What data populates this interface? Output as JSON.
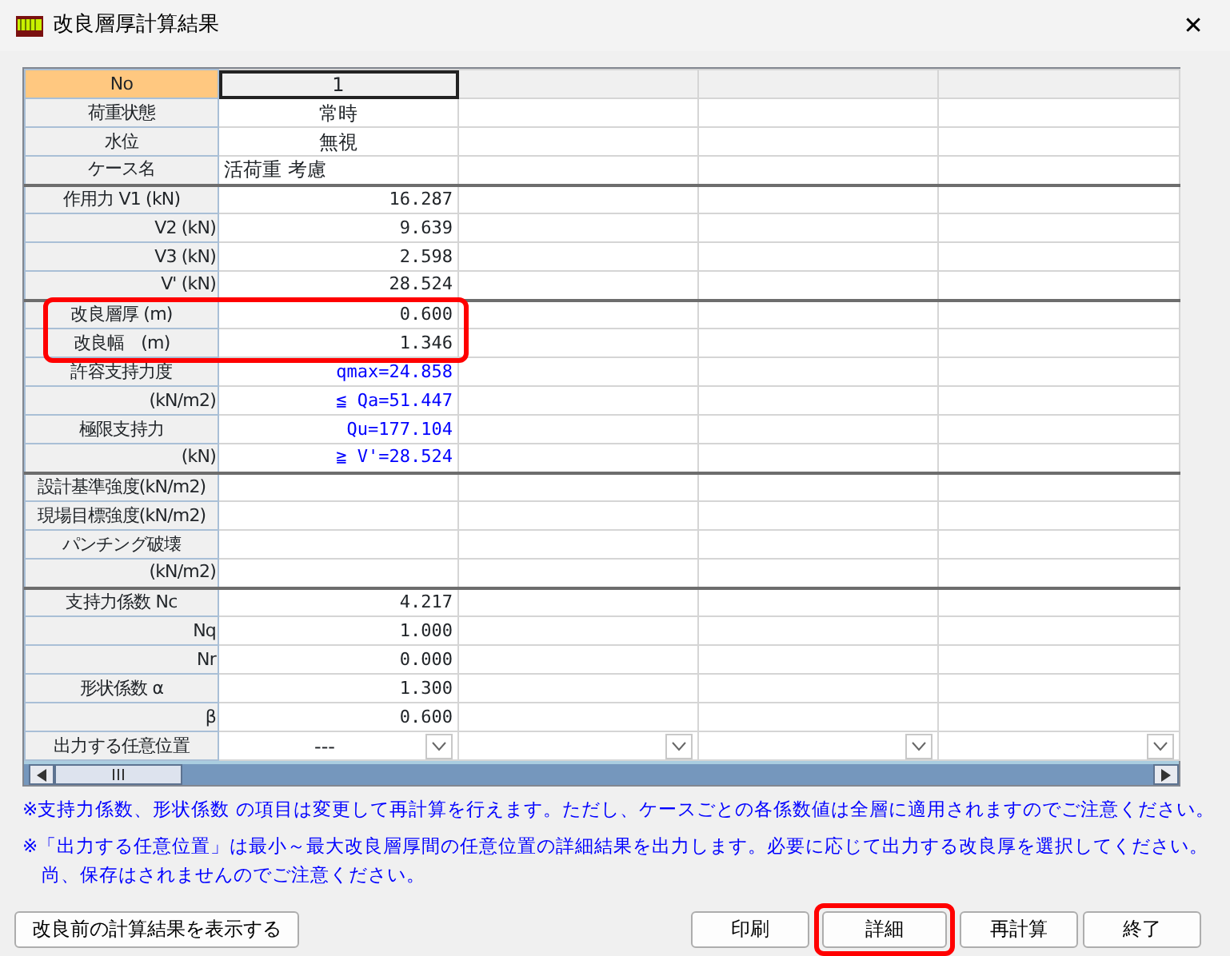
{
  "window": {
    "title": "改良層厚計算結果",
    "close": "✕"
  },
  "grid": {
    "corner": "No",
    "columns": [
      {
        "label": "1",
        "selected": true
      }
    ],
    "rows": [
      {
        "label": "荷重状態",
        "indented": false,
        "kind": "text",
        "value": "常時"
      },
      {
        "label": "水位",
        "indented": false,
        "kind": "text",
        "value": "無視"
      },
      {
        "label": "ケース名",
        "indented": false,
        "kind": "name",
        "value": "活荷重 考慮"
      },
      {
        "label": "作用力 V1 (kN)",
        "indented": false,
        "kind": "number",
        "value": "16.287",
        "group_start": true
      },
      {
        "label": "V2 (kN)",
        "indented": true,
        "kind": "number",
        "value": "9.639"
      },
      {
        "label": "V3 (kN)",
        "indented": true,
        "kind": "number",
        "value": "2.598"
      },
      {
        "label": "V' (kN)",
        "indented": true,
        "kind": "number",
        "value": "28.524"
      },
      {
        "label": "改良層厚 (m)",
        "indented": false,
        "kind": "number",
        "value": "0.600",
        "group_start": true,
        "highlighted": true
      },
      {
        "label": "改良幅　(m)",
        "indented": false,
        "kind": "number",
        "value": "1.346",
        "highlighted": true
      },
      {
        "label": "許容支持力度",
        "indented": false,
        "kind": "check",
        "value": "qmax=24.858"
      },
      {
        "label": "(kN/m2)",
        "indented": true,
        "kind": "check",
        "value": "≦ Qa=51.447"
      },
      {
        "label": "極限支持力",
        "indented": false,
        "kind": "check",
        "value": "Qu=177.104"
      },
      {
        "label": "(kN)",
        "indented": true,
        "kind": "check",
        "value": "≧ V'=28.524"
      },
      {
        "label": "設計基準強度(kN/m2)",
        "indented": false,
        "kind": "number",
        "group_start": true
      },
      {
        "label": "現場目標強度(kN/m2)",
        "indented": false,
        "kind": "number"
      },
      {
        "label": "パンチング破壊",
        "indented": false,
        "kind": "number"
      },
      {
        "label": "(kN/m2)",
        "indented": true,
        "kind": "number"
      },
      {
        "label": "支持力係数 Nc",
        "indented": false,
        "kind": "number",
        "value": "4.217",
        "group_start": true
      },
      {
        "label": "Nq",
        "indented": true,
        "kind": "number",
        "value": "1.000"
      },
      {
        "label": "Nr",
        "indented": true,
        "kind": "number",
        "value": "0.000"
      },
      {
        "label": "形状係数 α",
        "indented": false,
        "kind": "number",
        "value": "1.300"
      },
      {
        "label": "β",
        "indented": true,
        "kind": "number",
        "value": "0.600"
      },
      {
        "label": "出力する任意位置",
        "indented": false,
        "kind": "select",
        "value": "---"
      }
    ]
  },
  "notes": [
    {
      "kind": "note",
      "text": "※支持力係数、形状係数 の項目は変更して再計算を行えます。ただし、ケースごとの各係数値は全層に適用されますのでご注意ください。"
    },
    {
      "kind": "note",
      "text": "※「出力する任意位置」は最小～最大改良層厚間の任意位置の詳細結果を出力します。必要に応じて出力する改良厚を選択してください。"
    },
    {
      "kind": "continuation",
      "text": "尚、保存はされませんのでご注意ください。"
    }
  ],
  "buttons_left": [
    {
      "label": "改良前の計算結果を表示する",
      "highlighted": false
    }
  ],
  "buttons_right": [
    {
      "label": "印刷",
      "highlighted": false
    },
    {
      "label": "詳細",
      "highlighted": true
    },
    {
      "label": "再計算",
      "highlighted": false
    },
    {
      "label": "終了",
      "highlighted": false
    }
  ]
}
